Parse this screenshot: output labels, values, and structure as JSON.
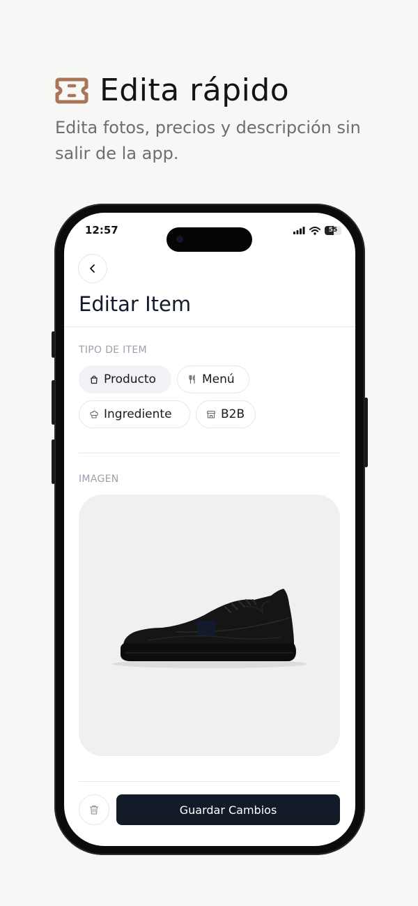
{
  "hero": {
    "title": "Edita rápido",
    "subtitle": "Edita fotos, precios y descripción sin salir de la app.",
    "icon": "ticket-icon",
    "accent_color": "#a87556"
  },
  "status_bar": {
    "time": "12:57",
    "battery": "55"
  },
  "screen": {
    "title": "Editar Item",
    "item_type": {
      "label": "TIPO DE ITEM",
      "options": [
        {
          "label": "Producto",
          "icon": "bag-icon",
          "selected": true
        },
        {
          "label": "Menú",
          "icon": "utensils-icon",
          "selected": false
        },
        {
          "label": "Ingrediente",
          "icon": "chef-hat-icon",
          "selected": false
        },
        {
          "label": "B2B",
          "icon": "store-icon",
          "selected": false
        }
      ]
    },
    "image": {
      "label": "IMAGEN",
      "content": "black sneaker photo"
    },
    "footer": {
      "save_label": "Guardar Cambios",
      "delete_icon": "trash-icon",
      "primary_color": "#131a28"
    }
  }
}
